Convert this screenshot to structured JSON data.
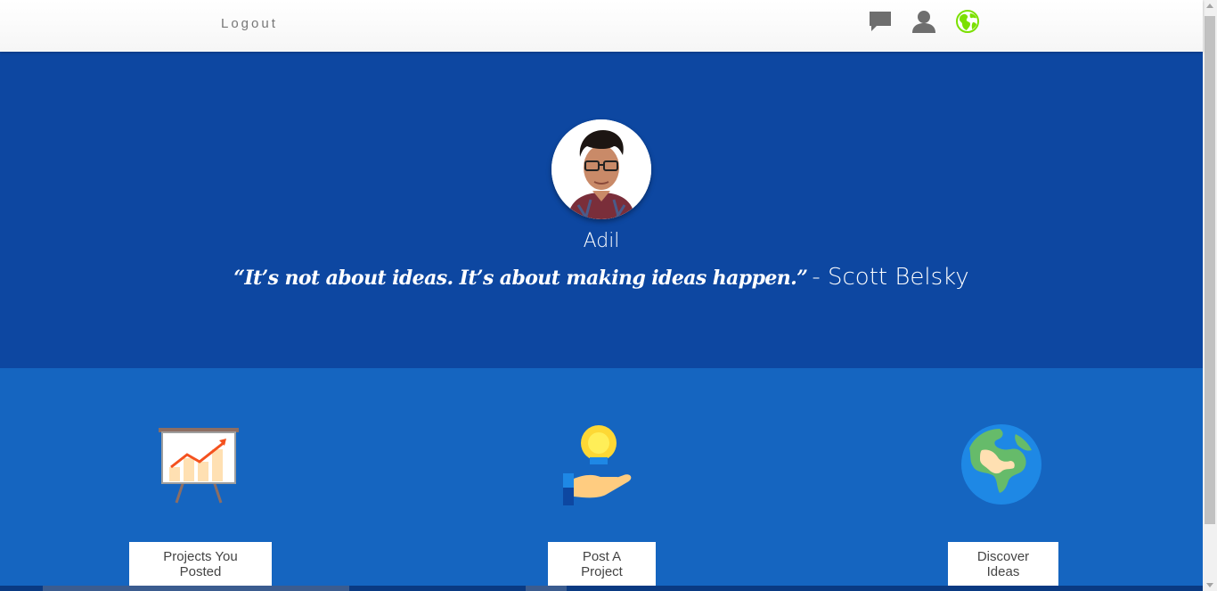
{
  "nav": {
    "logout_label": "Logout",
    "icons": [
      "chat-icon",
      "user-icon",
      "globe-icon"
    ]
  },
  "profile": {
    "name": "Adil",
    "quote": "“It’s not about ideas. It’s about making ideas happen.”",
    "quote_author": "- Scott Belsky"
  },
  "features": [
    {
      "icon": "presentation-chart-icon",
      "label": "Projects You Posted"
    },
    {
      "icon": "idea-hand-icon",
      "label": "Post A Project"
    },
    {
      "icon": "earth-icon",
      "label": "Discover Ideas"
    }
  ],
  "colors": {
    "hero_bg": "#0d47a1",
    "features_bg": "#1565c0",
    "globe_accent": "#7be000"
  }
}
